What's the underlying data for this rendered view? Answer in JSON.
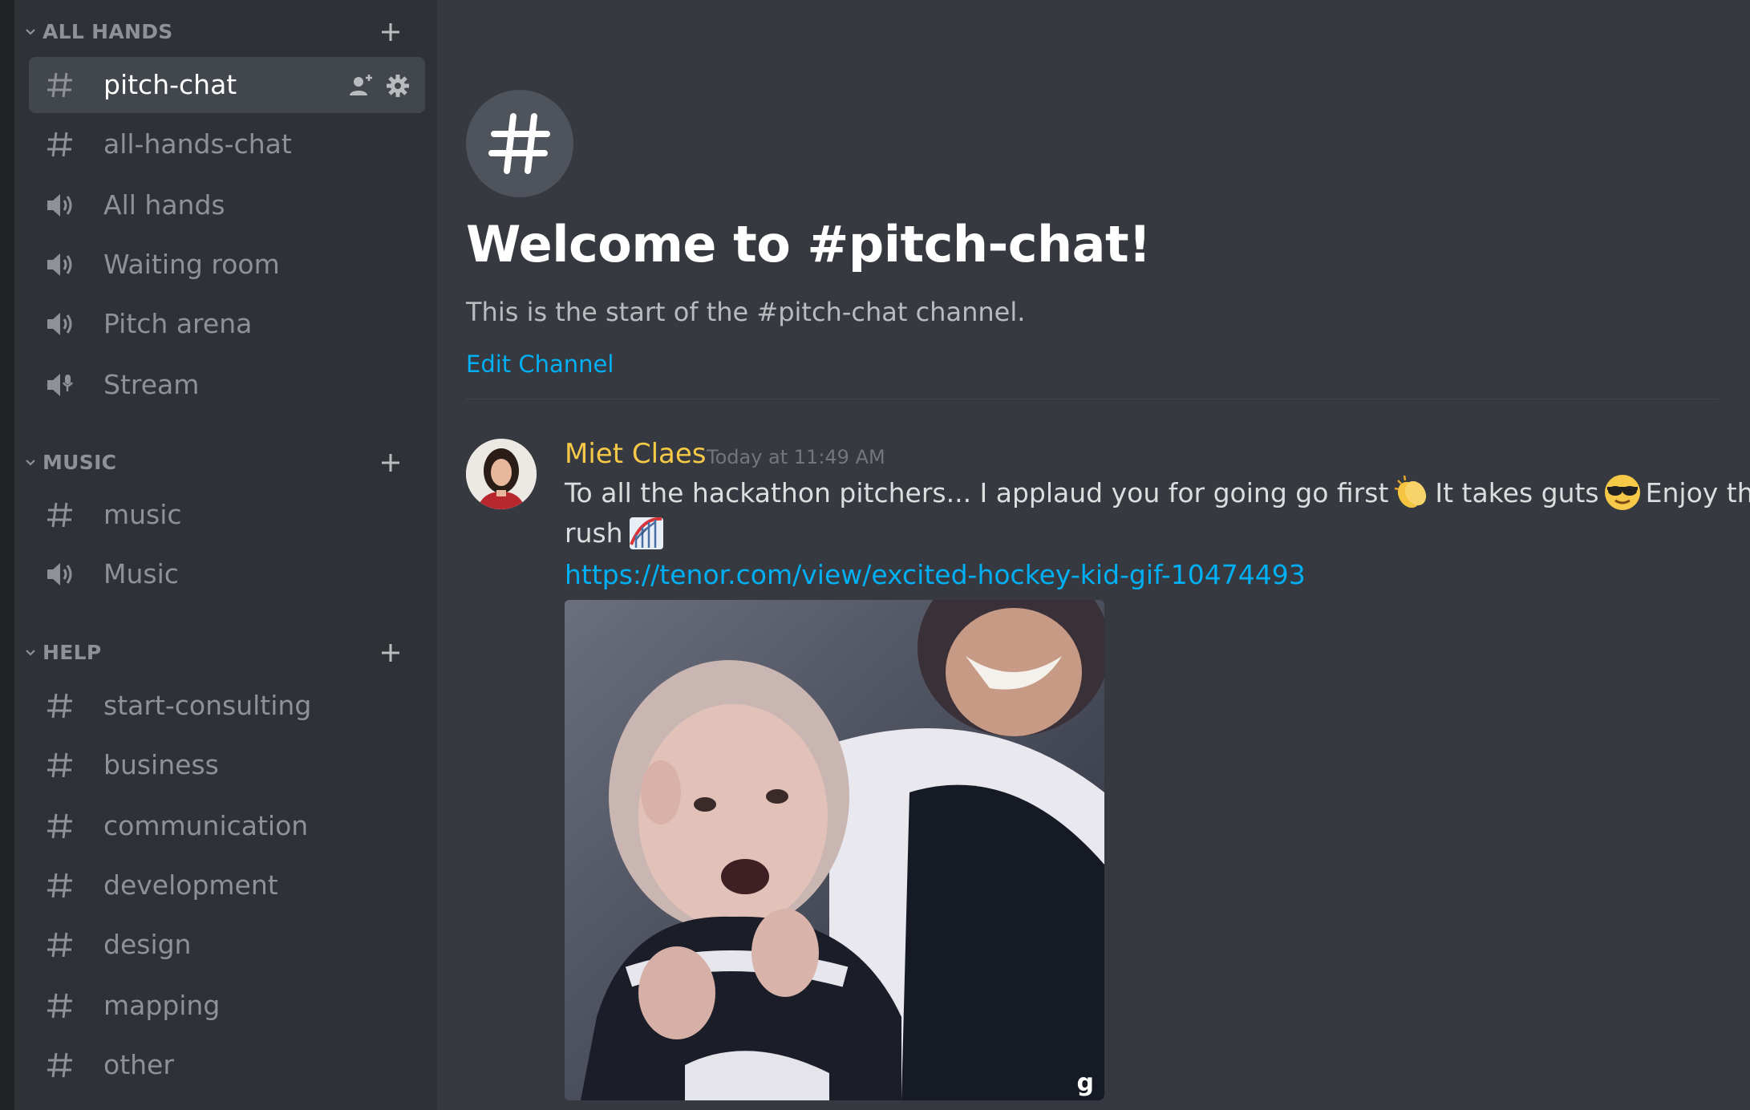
{
  "sidebar": {
    "categories": [
      {
        "name": "ALL HANDS",
        "channels": [
          {
            "label": "pitch-chat",
            "type": "text"
          },
          {
            "label": "all-hands-chat",
            "type": "text"
          },
          {
            "label": "All hands",
            "type": "voice"
          },
          {
            "label": "Waiting room",
            "type": "voice"
          },
          {
            "label": "Pitch arena",
            "type": "voice"
          },
          {
            "label": "Stream",
            "type": "stage"
          }
        ]
      },
      {
        "name": "MUSIC",
        "channels": [
          {
            "label": "music",
            "type": "text"
          },
          {
            "label": "Music",
            "type": "voice"
          }
        ]
      },
      {
        "name": "HELP",
        "channels": [
          {
            "label": "start-consulting",
            "type": "text"
          },
          {
            "label": "business",
            "type": "text"
          },
          {
            "label": "communication",
            "type": "text"
          },
          {
            "label": "development",
            "type": "text"
          },
          {
            "label": "design",
            "type": "text"
          },
          {
            "label": "mapping",
            "type": "text"
          },
          {
            "label": "other",
            "type": "text"
          }
        ]
      }
    ],
    "active_channel": "pitch-chat"
  },
  "welcome": {
    "title": "Welcome to #pitch-chat!",
    "subtitle": "This is the start of the #pitch-chat channel.",
    "edit_label": "Edit Channel"
  },
  "message": {
    "author": "Miet Claes",
    "timestamp": "Today at 11:49 AM",
    "text_part1": "To all the hackathon pitchers... I applaud you for going go first",
    "text_part2": "It takes guts",
    "text_part3": "Enjoy the rush",
    "emojis": [
      "clapping-hands-emoji",
      "sunglasses-emoji",
      "roller-coaster-emoji"
    ],
    "link": "https://tenor.com/view/excited-hockey-kid-gif-10474493",
    "gif_watermark": "g"
  },
  "colors": {
    "background": "#36393f",
    "sidebar": "#2f3136",
    "active_channel": "#42464d",
    "link": "#00b0f4",
    "author": "#f7c948",
    "muted": "#8e9297"
  }
}
